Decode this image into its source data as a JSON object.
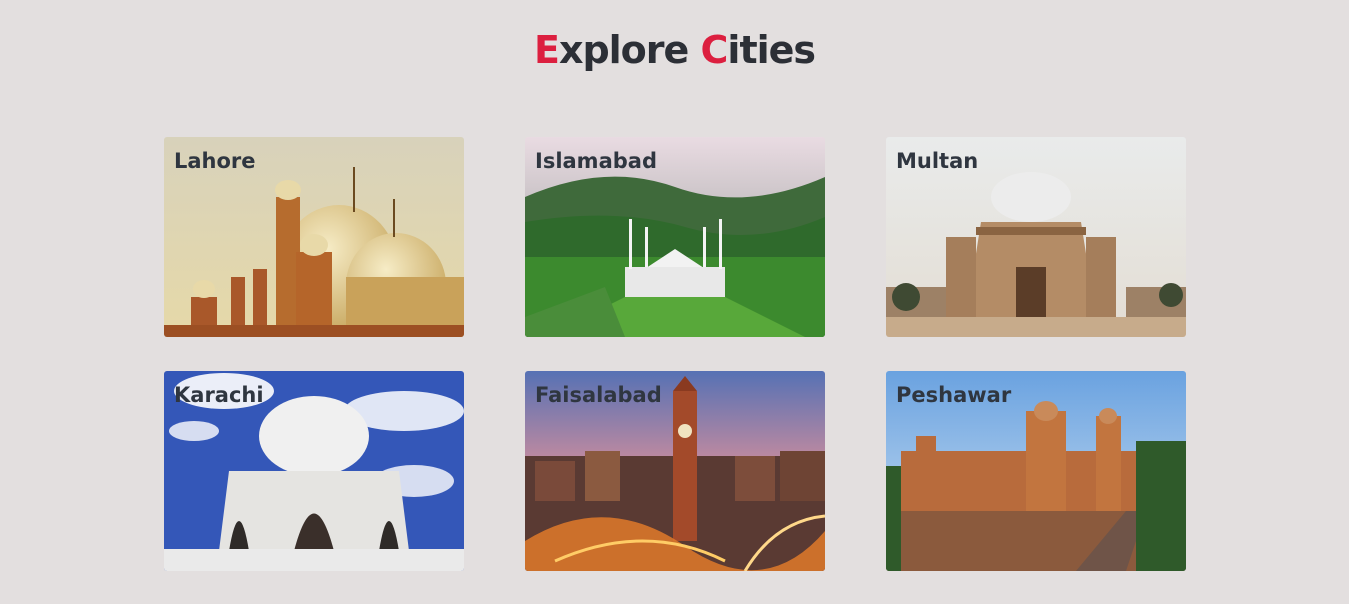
{
  "header": {
    "title_part1_accent": "E",
    "title_part1_rest": "xplore ",
    "title_part2_accent": "C",
    "title_part2_rest": "ities"
  },
  "cities": [
    {
      "name": "Lahore"
    },
    {
      "name": "Islamabad"
    },
    {
      "name": "Multan"
    },
    {
      "name": "Karachi"
    },
    {
      "name": "Faisalabad"
    },
    {
      "name": "Peshawar"
    }
  ],
  "colors": {
    "background": "#e3dfdf",
    "accent": "#dc1f3f",
    "text": "#2c2f36"
  }
}
